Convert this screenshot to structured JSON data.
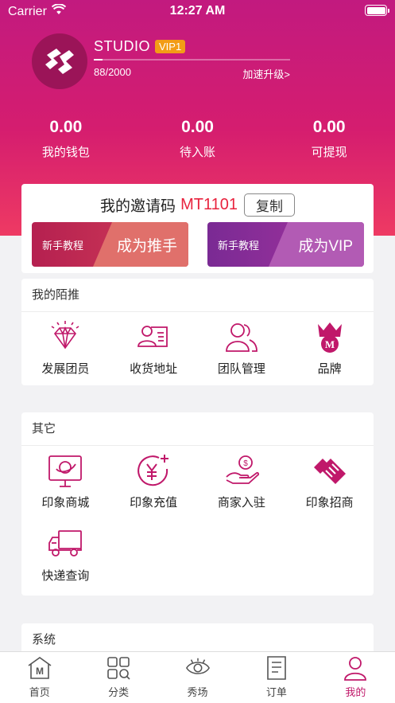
{
  "status_bar": {
    "carrier": "Carrier",
    "time": "12:27 AM"
  },
  "profile": {
    "name": "STUDIO",
    "vip_level": "VIP1",
    "points": "88/2000",
    "progress": 0.044,
    "upgrade_link": "加速升级>"
  },
  "stats": [
    {
      "value": "0.00",
      "label": "我的钱包"
    },
    {
      "value": "0.00",
      "label": "待入账"
    },
    {
      "value": "0.00",
      "label": "可提现"
    }
  ],
  "invite": {
    "label": "我的邀请码",
    "code": "MT1101",
    "copy_label": "复制",
    "promos": [
      {
        "small": "新手教程",
        "big": "成为推手"
      },
      {
        "small": "新手教程",
        "big": "成为VIP"
      }
    ]
  },
  "sections": {
    "mine": {
      "title": "我的陌推",
      "items": [
        {
          "label": "发展团员",
          "icon": "diamond-icon"
        },
        {
          "label": "收货地址",
          "icon": "address-card-icon"
        },
        {
          "label": "团队管理",
          "icon": "team-icon"
        },
        {
          "label": "品牌",
          "icon": "crown-icon"
        }
      ]
    },
    "other": {
      "title": "其它",
      "items": [
        {
          "label": "印象商城",
          "icon": "monitor-icon"
        },
        {
          "label": "印象充值",
          "icon": "yen-plus-icon"
        },
        {
          "label": "商家入驻",
          "icon": "coin-hand-icon"
        },
        {
          "label": "印象招商",
          "icon": "handshake-icon"
        },
        {
          "label": "快递查询",
          "icon": "truck-icon"
        }
      ]
    },
    "system": {
      "title": "系统"
    }
  },
  "tabbar": [
    {
      "label": "首页",
      "icon": "home-icon",
      "active": false
    },
    {
      "label": "分类",
      "icon": "category-icon",
      "active": false
    },
    {
      "label": "秀场",
      "icon": "eye-icon",
      "active": false
    },
    {
      "label": "订单",
      "icon": "order-icon",
      "active": false
    },
    {
      "label": "我的",
      "icon": "profile-icon",
      "active": true
    }
  ],
  "colors": {
    "brand_primary": "#c0186a",
    "invite_code": "#e8233e",
    "vip_badge": "#f39c16",
    "promo_red": "#c73354",
    "promo_purple": "#8e2d9a"
  }
}
